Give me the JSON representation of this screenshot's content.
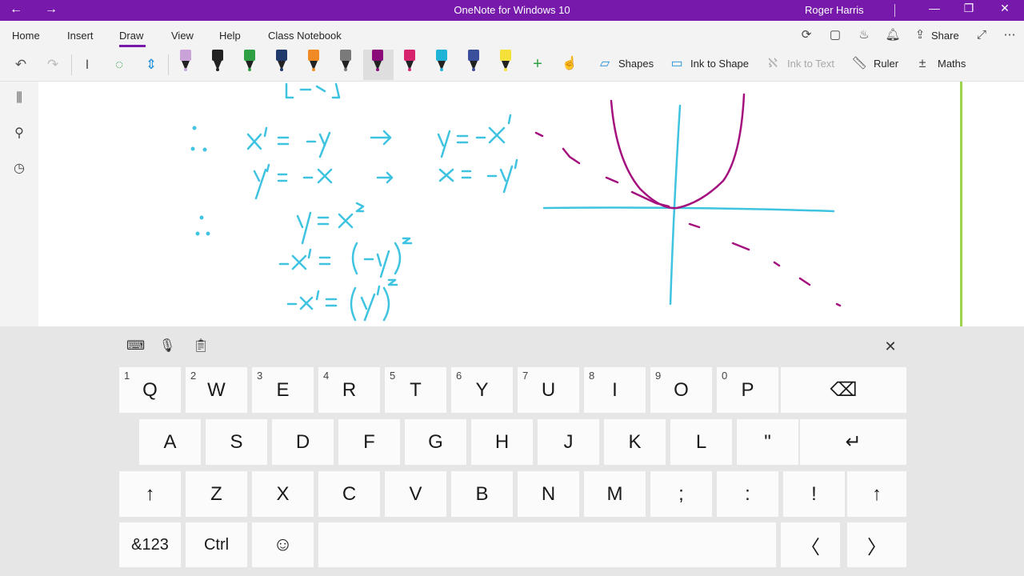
{
  "titlebar": {
    "back_icon": "arrow-left-icon",
    "forward_icon": "arrow-right-icon",
    "title": "OneNote for Windows 10",
    "user": "Roger Harris",
    "minimize_glyph": "—",
    "restore_glyph": "❐",
    "close_glyph": "✕"
  },
  "ribbon": {
    "tabs": [
      {
        "label": "Home"
      },
      {
        "label": "Insert"
      },
      {
        "label": "Draw"
      },
      {
        "label": "View"
      },
      {
        "label": "Help"
      },
      {
        "label": "Class Notebook"
      }
    ],
    "active_tab": "Draw",
    "share_label": "Share"
  },
  "toolbar": {
    "pens": [
      {
        "name": "pen-pink-highlighter",
        "color": "#c8a2d8"
      },
      {
        "name": "pen-black",
        "color": "#222222"
      },
      {
        "name": "pen-green",
        "color": "#2ea043"
      },
      {
        "name": "pen-navy",
        "color": "#1f3a6b"
      },
      {
        "name": "pen-orange",
        "color": "#f08a24"
      },
      {
        "name": "pen-gray-pattern",
        "color": "#7a7a7a"
      },
      {
        "name": "pen-purple-selected",
        "color": "#8b0a7a"
      },
      {
        "name": "pen-magenta",
        "color": "#d6246e"
      },
      {
        "name": "pen-cyan",
        "color": "#1fb3d8"
      },
      {
        "name": "pen-galaxy",
        "color": "#3a4f9c"
      },
      {
        "name": "pen-yellow-highlighter",
        "color": "#f5e03a"
      }
    ],
    "shapes_label": "Shapes",
    "ink_to_shape_label": "Ink to Shape",
    "ink_to_text_label": "Ink to Text",
    "ruler_label": "Ruler",
    "maths_label": "Maths"
  },
  "keyboard": {
    "row1": [
      {
        "key": "Q",
        "sub": "1"
      },
      {
        "key": "W",
        "sub": "2"
      },
      {
        "key": "E",
        "sub": "3"
      },
      {
        "key": "R",
        "sub": "4"
      },
      {
        "key": "T",
        "sub": "5"
      },
      {
        "key": "Y",
        "sub": "6"
      },
      {
        "key": "U",
        "sub": "7"
      },
      {
        "key": "I",
        "sub": "8"
      },
      {
        "key": "O",
        "sub": "9"
      },
      {
        "key": "P",
        "sub": "0"
      }
    ],
    "backspace_glyph": "⌫",
    "row2": [
      "A",
      "S",
      "D",
      "F",
      "G",
      "H",
      "J",
      "K",
      "L",
      "\""
    ],
    "enter_glyph": "↵",
    "shift_glyph": "↑",
    "row3": [
      "Z",
      "X",
      "C",
      "V",
      "B",
      "N",
      "M",
      ";",
      ":",
      "!"
    ],
    "symbols_label": "&123",
    "ctrl_label": "Ctrl",
    "emoji_glyph": "☺",
    "left_glyph": "〈",
    "right_glyph": "〉",
    "close_glyph": "✕"
  },
  "colors": {
    "accent": "#7719aa",
    "ink_cyan": "#3ec3e0",
    "ink_magenta": "#a4107e",
    "page_margin": "#9bd44a"
  }
}
